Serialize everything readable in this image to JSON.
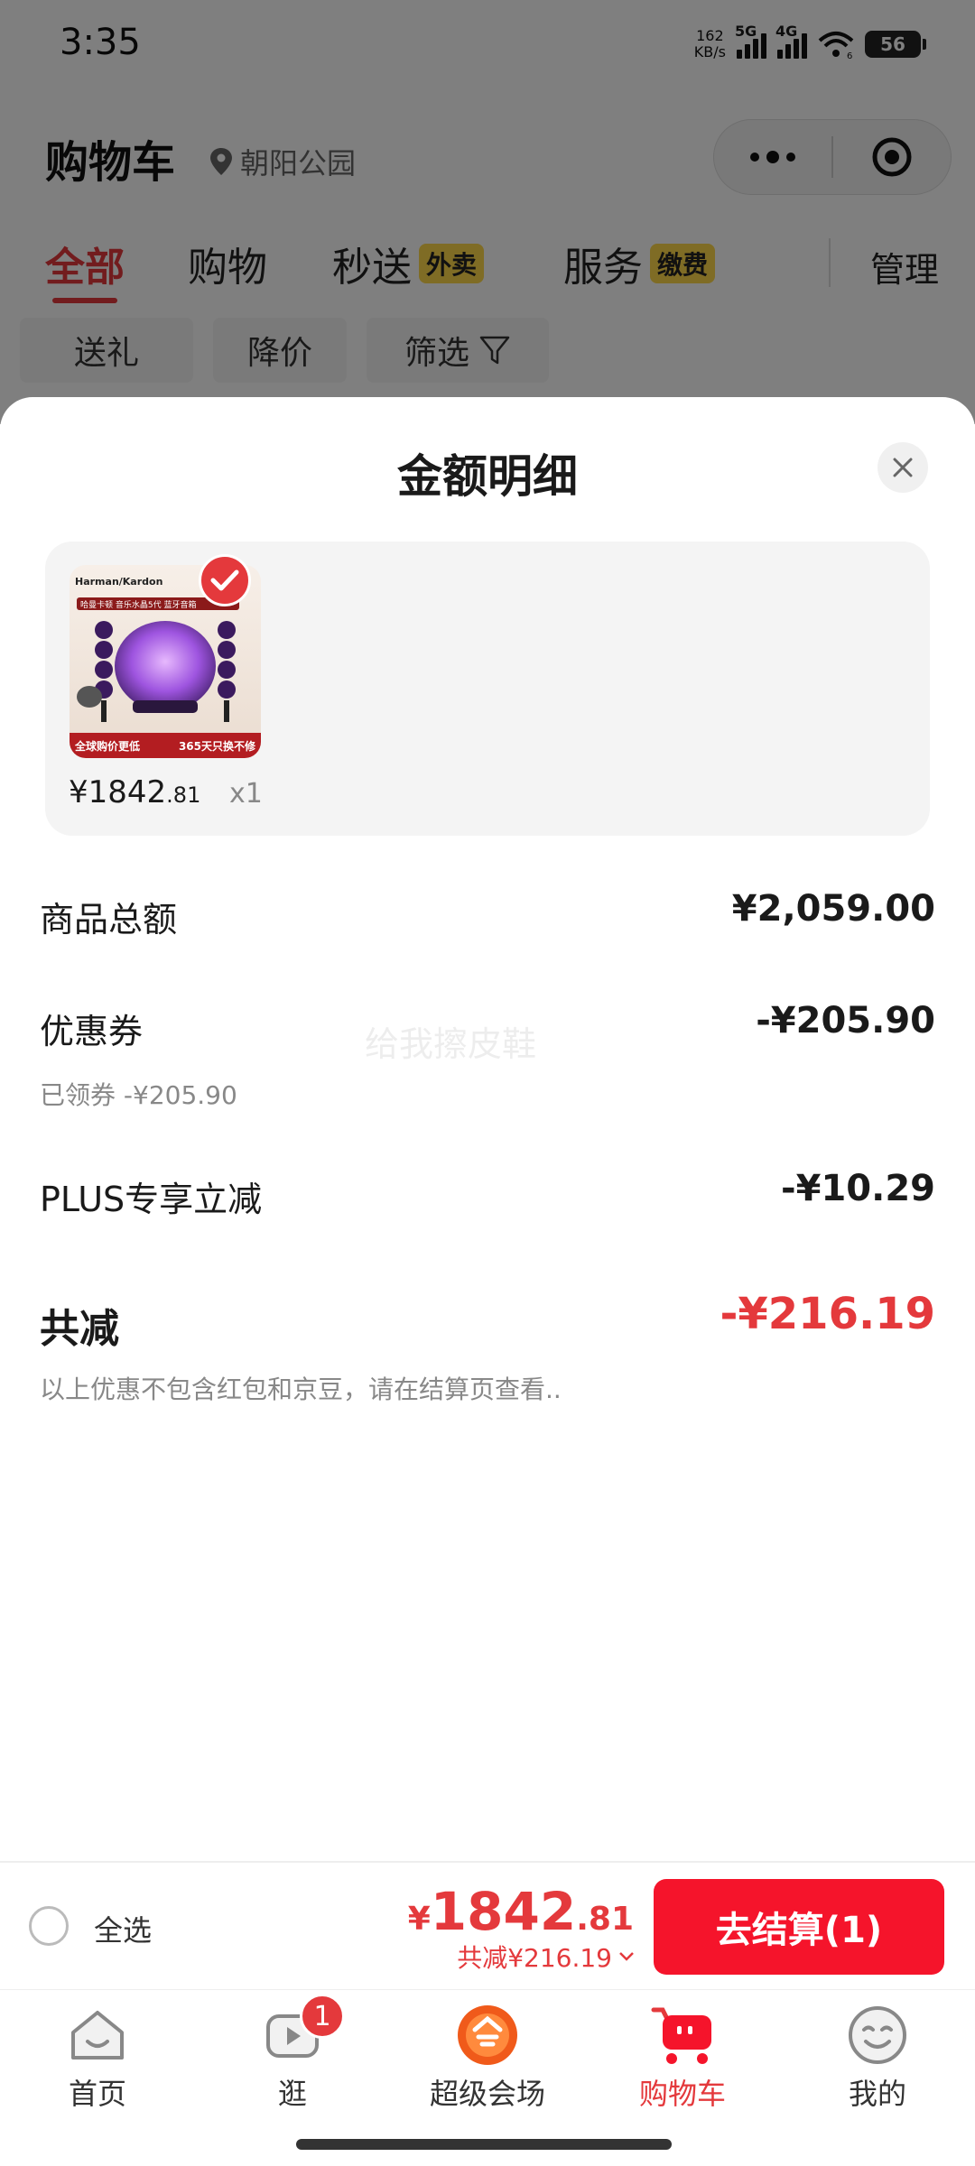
{
  "status_bar": {
    "time": "3:35",
    "net_speed_value": "162",
    "net_speed_unit": "KB/s",
    "sim1": "5G",
    "sim2": "4G",
    "wifi_label": "6",
    "battery": "56"
  },
  "header": {
    "title": "购物车",
    "location": "朝阳公园"
  },
  "tabs": [
    {
      "label": "全部",
      "active": true
    },
    {
      "label": "购物",
      "active": false
    },
    {
      "label": "秒送",
      "badge": "外卖",
      "active": false
    },
    {
      "label": "服务",
      "badge": "缴费",
      "active": false
    }
  ],
  "manage_label": "管理",
  "filter_chips": [
    {
      "label": "送礼"
    },
    {
      "label": "降价"
    },
    {
      "label": "筛选"
    }
  ],
  "sheet": {
    "title": "金额明细",
    "product": {
      "brand": "Harman/Kardon",
      "image_banner_top": "哈曼卡顿 音乐水晶5代 蓝牙音箱",
      "image_banner_left": "全球购价更低",
      "image_banner_right": "365天只换不修",
      "price_integer": "¥1842",
      "price_decimal": ".81",
      "quantity": "x1"
    },
    "rows": {
      "goods_total_label": "商品总额",
      "goods_total_value": "¥2,059.00",
      "coupon_label": "优惠券",
      "coupon_value": "-¥205.90",
      "coupon_sub": "已领券 -¥205.90",
      "plus_label": "PLUS专享立减",
      "plus_value": "-¥10.29"
    },
    "watermark": "给我擦皮鞋",
    "total_label": "共减",
    "total_value": "-¥216.19",
    "note": "以上优惠不包含红包和京豆，请在结算页查看.."
  },
  "checkout": {
    "select_all_label": "全选",
    "price_currency": "¥",
    "price_integer": "1842",
    "price_decimal": ".81",
    "discount_text": "共减¥216.19",
    "button_label": "去结算(1)"
  },
  "bottom_nav": [
    {
      "label": "首页",
      "icon": "home-icon"
    },
    {
      "label": "逛",
      "icon": "video-icon",
      "badge": "1"
    },
    {
      "label": "超级会场",
      "icon": "super-venue-icon"
    },
    {
      "label": "购物车",
      "icon": "cart-icon",
      "active": true
    },
    {
      "label": "我的",
      "icon": "profile-icon"
    }
  ],
  "colors": {
    "accent": "#e4393c",
    "checkout_button": "#f5142b"
  }
}
